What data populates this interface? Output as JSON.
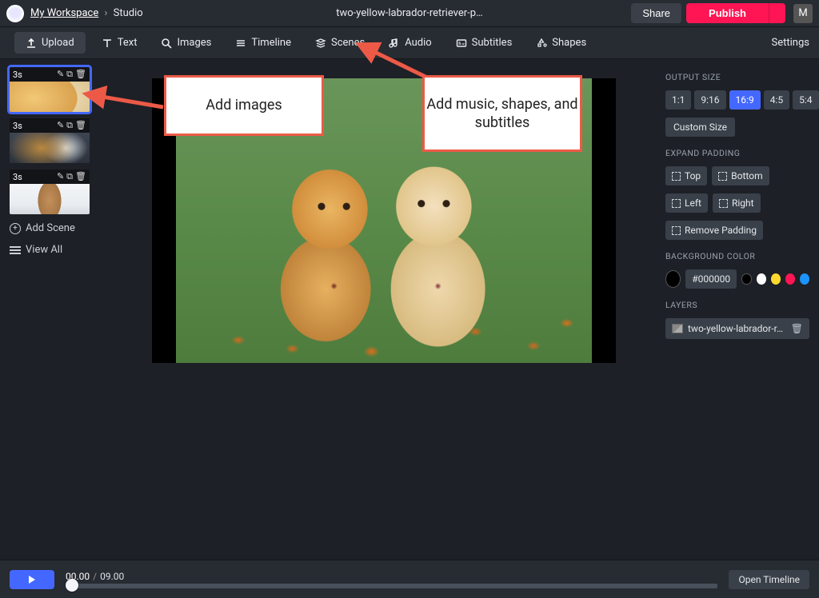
{
  "breadcrumb": {
    "workspace": "My Workspace",
    "studio": "Studio"
  },
  "title": "two-yellow-labrador-retriever-p…",
  "buttons": {
    "share": "Share",
    "publish": "Publish"
  },
  "user_initial": "M",
  "tools": {
    "upload": "Upload",
    "text": "Text",
    "images": "Images",
    "timeline": "Timeline",
    "scenes": "Scenes",
    "audio": "Audio",
    "subtitles": "Subtitles",
    "shapes": "Shapes",
    "settings": "Settings"
  },
  "scenes": [
    {
      "duration": "3s",
      "image_class": "img-puppies",
      "selected": true
    },
    {
      "duration": "3s",
      "image_class": "img-dogplay",
      "selected": false
    },
    {
      "duration": "3s",
      "image_class": "img-figure",
      "selected": false
    }
  ],
  "scene_actions": {
    "add": "Add Scene",
    "view_all": "View All"
  },
  "right_panel": {
    "output_size_label": "OUTPUT SIZE",
    "ratios": [
      "1:1",
      "9:16",
      "16:9",
      "4:5",
      "5:4"
    ],
    "active_ratio": "16:9",
    "custom_size": "Custom Size",
    "expand_label": "EXPAND PADDING",
    "pad": {
      "top": "Top",
      "bottom": "Bottom",
      "left": "Left",
      "right": "Right"
    },
    "remove_padding": "Remove Padding",
    "bg_label": "BACKGROUND COLOR",
    "bg_hex": "#000000",
    "swatches": [
      "#000000",
      "#ffffff",
      "#ffd92e",
      "#ff1554",
      "#1c93ff"
    ],
    "layers_label": "LAYERS",
    "layer_name": "two-yellow-labrador-r…"
  },
  "timeline": {
    "current": "00.00",
    "total": "09.00",
    "open": "Open Timeline"
  },
  "callouts": {
    "add_images": "Add images",
    "add_music": "Add music, shapes, and subtitles"
  }
}
